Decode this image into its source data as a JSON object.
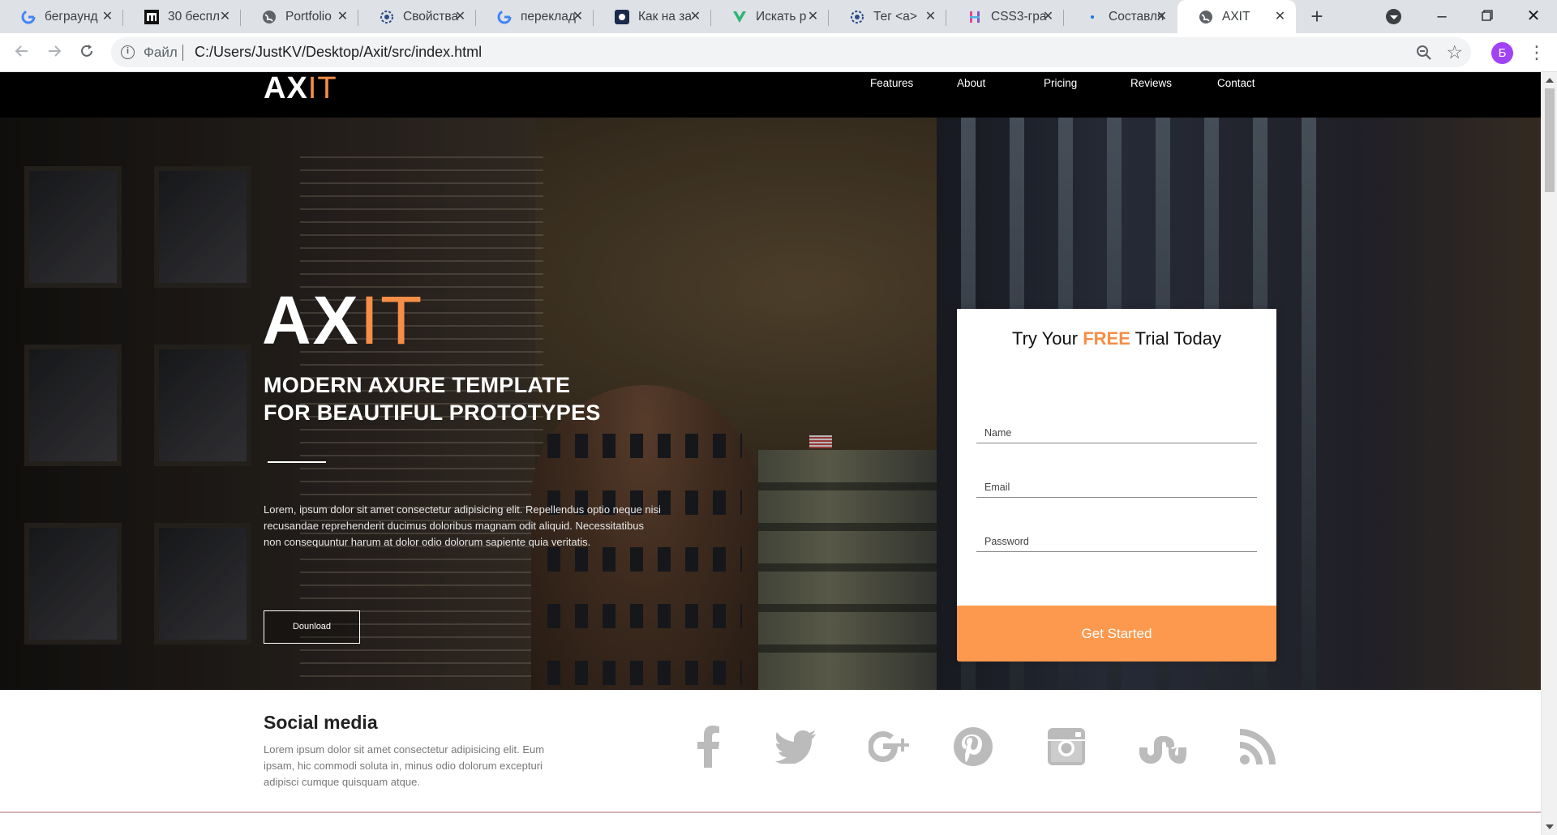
{
  "browser": {
    "tabs": [
      {
        "title": "бегрaунд",
        "favicon": "google-g-icon"
      },
      {
        "title": "30 беспл",
        "favicon": "m-logo-icon"
      },
      {
        "title": "Portfolio",
        "favicon": "globe-icon"
      },
      {
        "title": "Свойства",
        "favicon": "gear-wheel-icon"
      },
      {
        "title": "переклад",
        "favicon": "google-g-icon"
      },
      {
        "title": "Как на за",
        "favicon": "app-square-icon"
      },
      {
        "title": "Искать р",
        "favicon": "v-logo-icon"
      },
      {
        "title": "Тег <a>",
        "favicon": "gear-wheel-icon"
      },
      {
        "title": "CSS3-гра",
        "favicon": "h-logo-icon"
      },
      {
        "title": "Составля",
        "favicon": "dot-icon"
      },
      {
        "title": "AXIT",
        "favicon": "globe-icon",
        "active": true
      }
    ],
    "new_tab_label": "+",
    "address": {
      "scheme_label": "Файл",
      "url": "C:/Users/JustKV/Desktop/Axit/src/index.html"
    },
    "profile_initial": "Б"
  },
  "site": {
    "logo": {
      "main": "AX",
      "accent": "IT"
    },
    "nav": [
      "Features",
      "About",
      "Pricing",
      "Reviews",
      "Contact"
    ],
    "hero": {
      "logo": {
        "main": "AX",
        "accent": "IT"
      },
      "heading_line1": "MODERN AXURE TEMPLATE",
      "heading_line2": "FOR BEAUTIFUL PROTOTYPES",
      "text": "Lorem, ipsum dolor sit amet consectetur adipisicing elit. Repellendus optio neque nisi recusandae reprehenderit ducimus doloribus magnam odit aliquid. Necessitatibus non consequuntur harum at dolor odio dolorum sapiente quia veritatis.",
      "download_label": "Dounload"
    },
    "trial": {
      "title_before": "Try Your ",
      "title_free": "FREE",
      "title_after": " Trial Today",
      "name_placeholder": "Name",
      "email_placeholder": "Email",
      "password_placeholder": "Password",
      "submit_label": "Get Started"
    },
    "social": {
      "title": "Social media",
      "text": "Lorem ipsum dolor sit amet consectetur adipisicing elit. Eum ipsam, hic commodi soluta in, minus odio dolorum excepturi adipisci cumque quisquam atque.",
      "icons": [
        "facebook-icon",
        "twitter-icon",
        "google-plus-icon",
        "pinterest-icon",
        "instagram-icon",
        "stumbleupon-icon",
        "rss-icon"
      ]
    }
  },
  "colors": {
    "accent": "#f68e47",
    "button": "#fc994e",
    "header_bg": "#000000",
    "icon_grey": "#bbbbbb"
  }
}
